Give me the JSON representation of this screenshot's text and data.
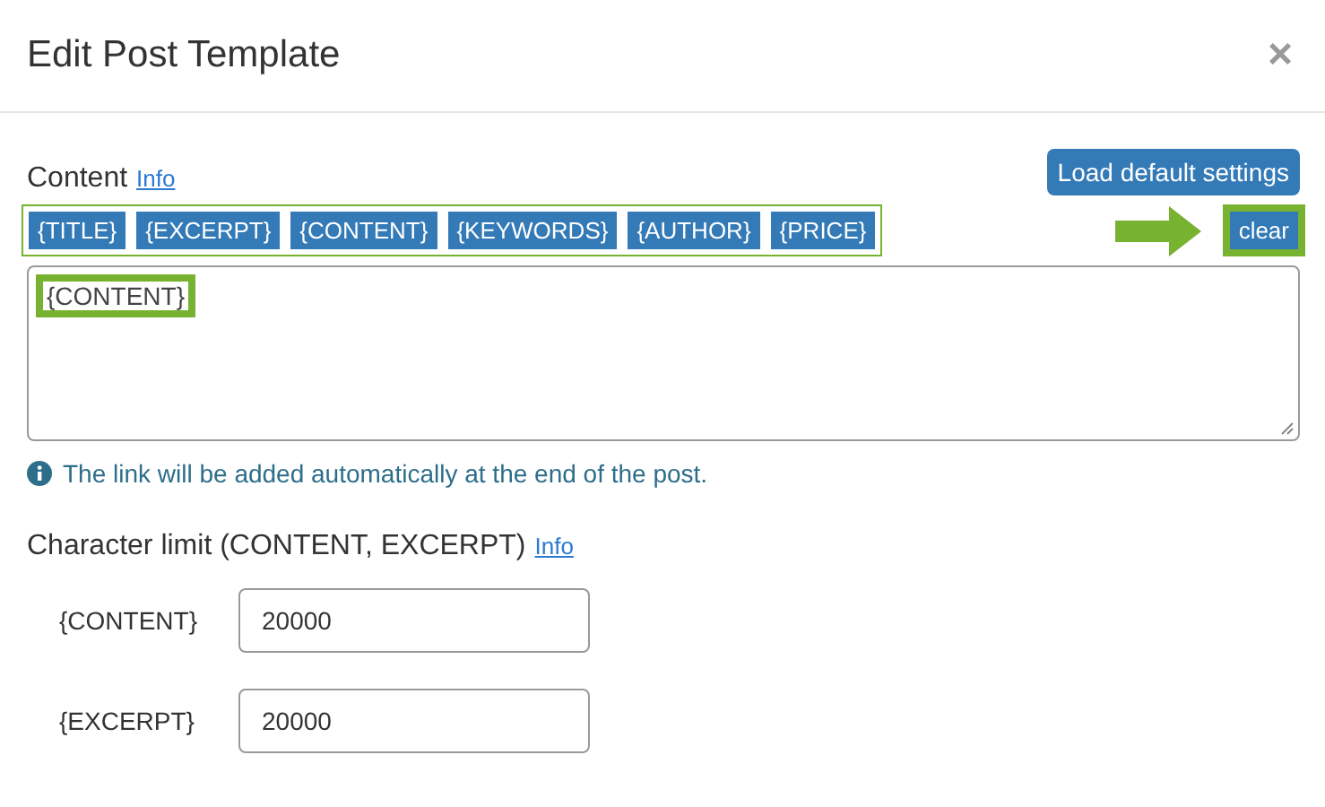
{
  "dialog": {
    "title": "Edit Post Template",
    "close": "×"
  },
  "content": {
    "label": "Content",
    "info_link": "Info",
    "load_button": "Load default settings",
    "tags": [
      {
        "label": "{TITLE}"
      },
      {
        "label": "{EXCERPT}"
      },
      {
        "label": "{CONTENT}"
      },
      {
        "label": "{KEYWORDS}"
      },
      {
        "label": "{AUTHOR}"
      },
      {
        "label": "{PRICE}"
      }
    ],
    "clear_button": "clear",
    "value": "{CONTENT}",
    "note": "The link will be added automatically at the end of the post."
  },
  "limits": {
    "label": "Character limit (CONTENT, EXCERPT)",
    "info_link": "Info",
    "rows": [
      {
        "label": "{CONTENT}",
        "value": "20000"
      },
      {
        "label": "{EXCERPT}",
        "value": "20000"
      }
    ]
  }
}
